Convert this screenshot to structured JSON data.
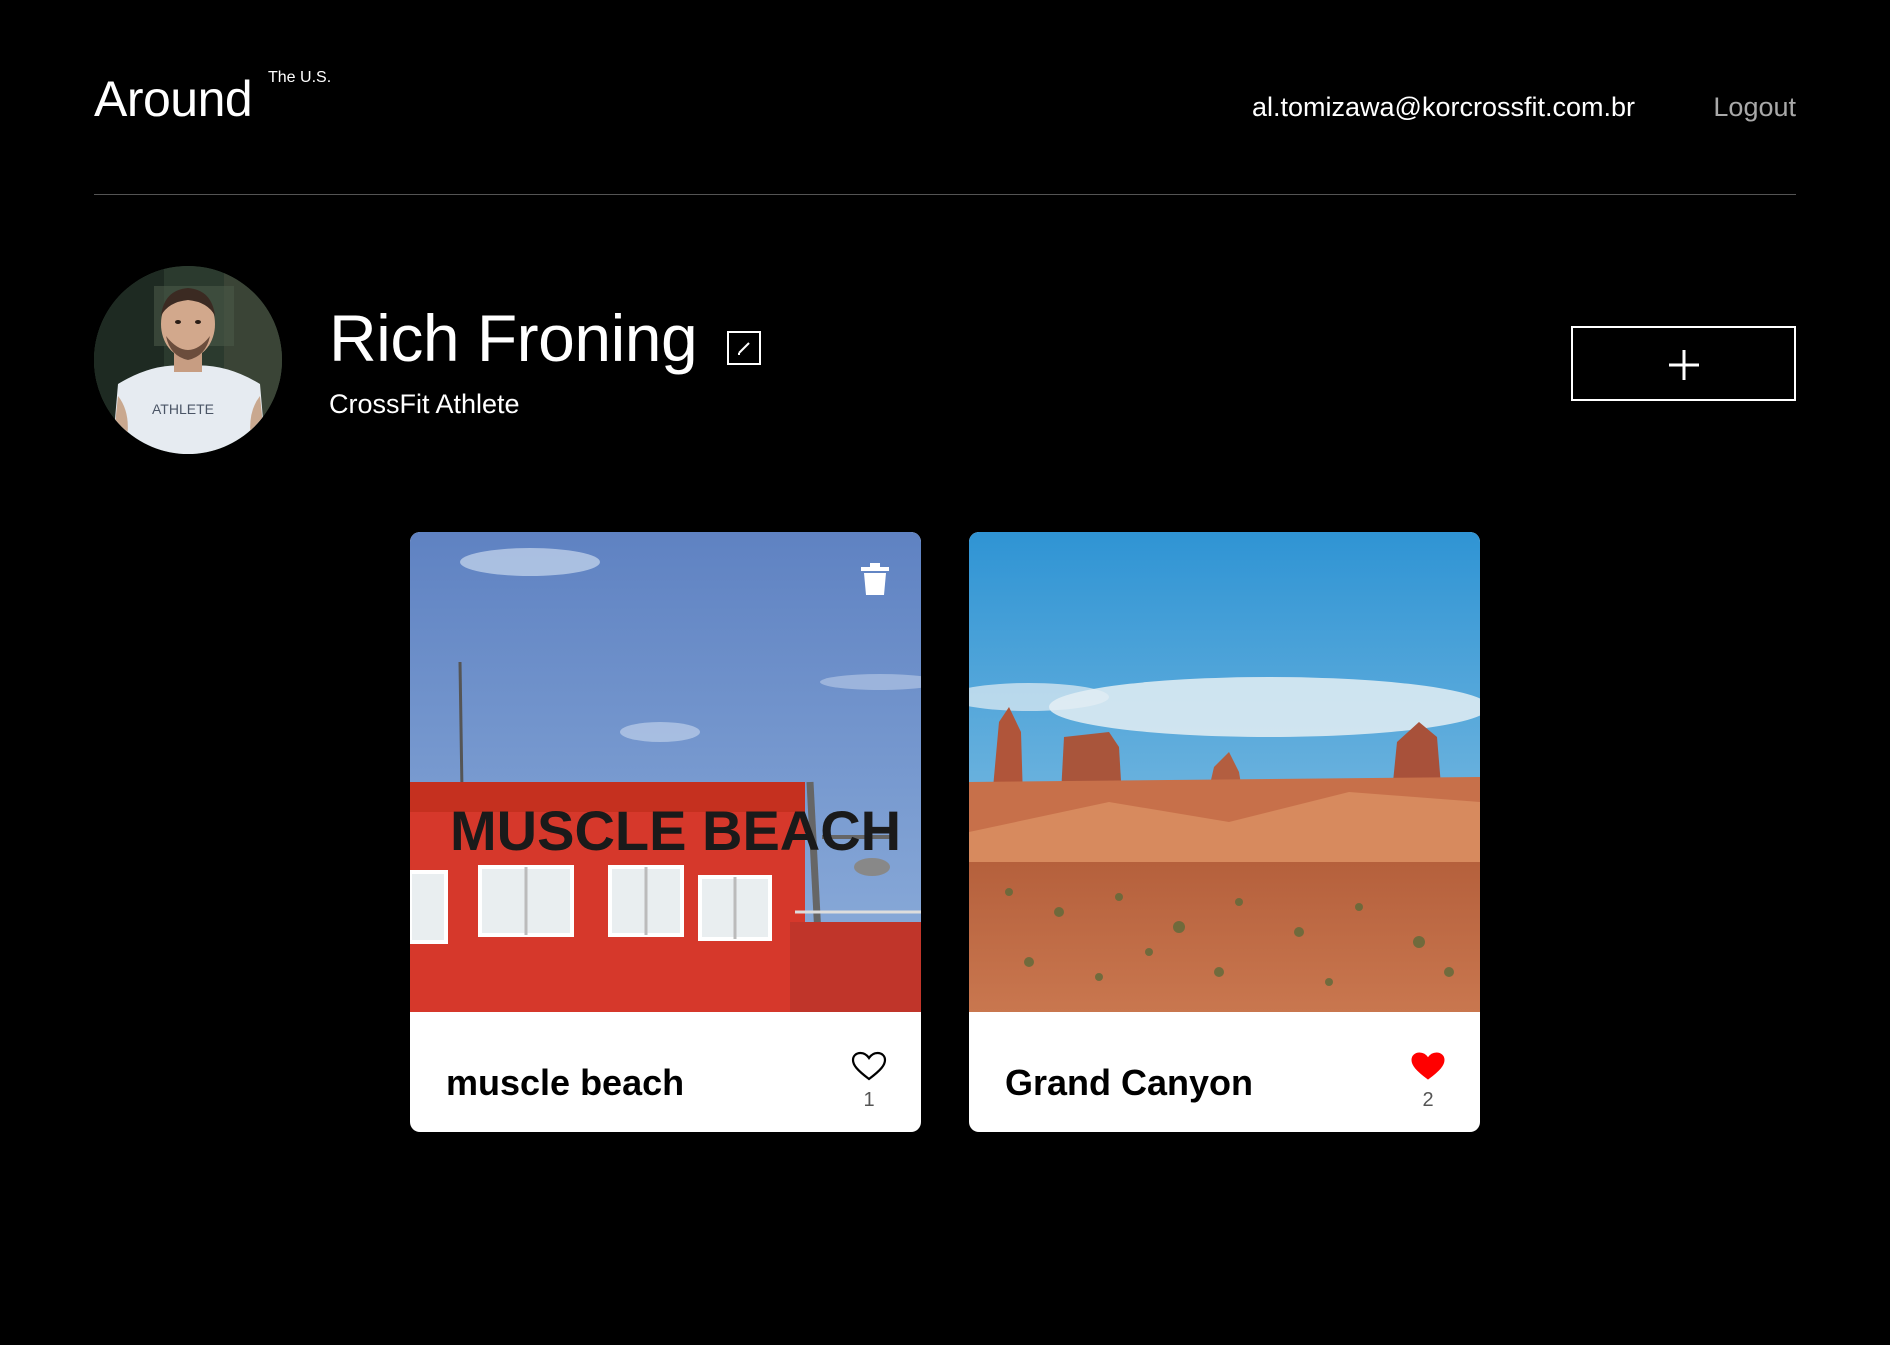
{
  "header": {
    "logo": "Around",
    "logo_superscript": "The U.S.",
    "user_email": "al.tomizawa@korcrossfit.com.br",
    "logout_label": "Logout"
  },
  "profile": {
    "name": "Rich Froning",
    "about": "CrossFit Athlete",
    "edit_icon": "pencil-icon",
    "add_icon": "plus-icon"
  },
  "cards": [
    {
      "title": "muscle beach",
      "likes": "1",
      "liked": false,
      "deletable": true,
      "image_desc": "red building with sign MUSCLE BEACH under blue sky",
      "image_sign_text": "MUSCLE BEACH"
    },
    {
      "title": "Grand Canyon",
      "likes": "2",
      "liked": true,
      "deletable": false,
      "image_desc": "desert with red rock buttes under blue sky"
    }
  ],
  "colors": {
    "background": "#000000",
    "text": "#ffffff",
    "muted": "#a9a9a9",
    "like_active": "#ff0000",
    "card_background": "#ffffff"
  }
}
